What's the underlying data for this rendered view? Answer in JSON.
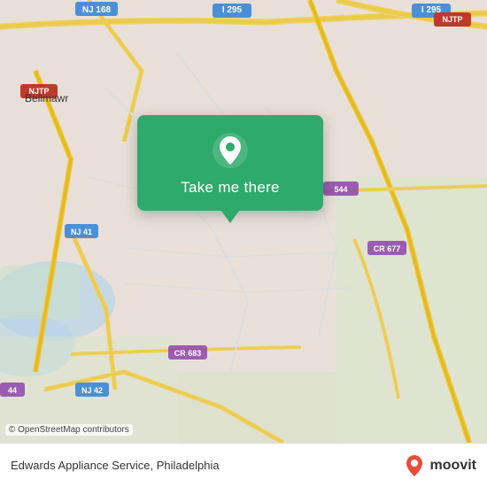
{
  "map": {
    "background_color": "#e8e0d8",
    "attribution": "© OpenStreetMap contributors"
  },
  "popup": {
    "button_label": "Take me there",
    "background_color": "#2eaa6c"
  },
  "bottom_bar": {
    "location_text": "Edwards Appliance Service, Philadelphia",
    "copyright_text": "© OpenStreetMap contributors",
    "brand": "moovit"
  }
}
